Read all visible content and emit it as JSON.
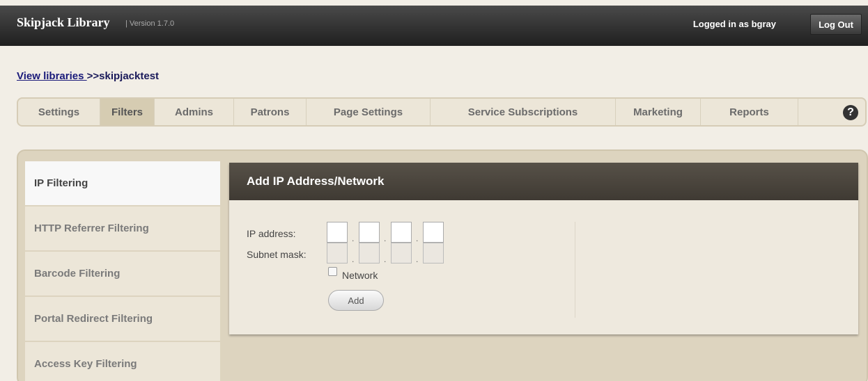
{
  "header": {
    "brand": "Skipjack Library",
    "version": "| Version 1.7.0",
    "logged_in": "Logged in as bgray",
    "logout_label": "Log Out"
  },
  "breadcrumb": {
    "link_label": "View libraries ",
    "current": ">>skipjacktest"
  },
  "tabs": [
    {
      "label": "Settings"
    },
    {
      "label": "Filters",
      "active": true
    },
    {
      "label": "Admins"
    },
    {
      "label": "Patrons"
    },
    {
      "label": "Page Settings"
    },
    {
      "label": "Service Subscriptions"
    },
    {
      "label": "Marketing"
    },
    {
      "label": "Reports"
    }
  ],
  "help_icon": "question-circle-icon",
  "sidebar": {
    "items": [
      {
        "label": "IP Filtering",
        "active": true
      },
      {
        "label": "HTTP Referrer Filtering"
      },
      {
        "label": "Barcode Filtering"
      },
      {
        "label": "Portal Redirect Filtering"
      },
      {
        "label": "Access Key Filtering"
      }
    ]
  },
  "form": {
    "title": "Add IP Address/Network",
    "ip_label": "IP address:",
    "subnet_label": "Subnet mask:",
    "dot": ".",
    "ip_values": [
      "",
      "",
      "",
      ""
    ],
    "subnet_values": [
      "",
      "",
      "",
      ""
    ],
    "network_label": "Network",
    "network_checked": false,
    "add_label": "Add"
  },
  "colors": {
    "topbar": "#2b2b2b",
    "tab_active": "#d6ccb2",
    "panel_header": "#4a453d",
    "link": "#1a1a7a"
  }
}
